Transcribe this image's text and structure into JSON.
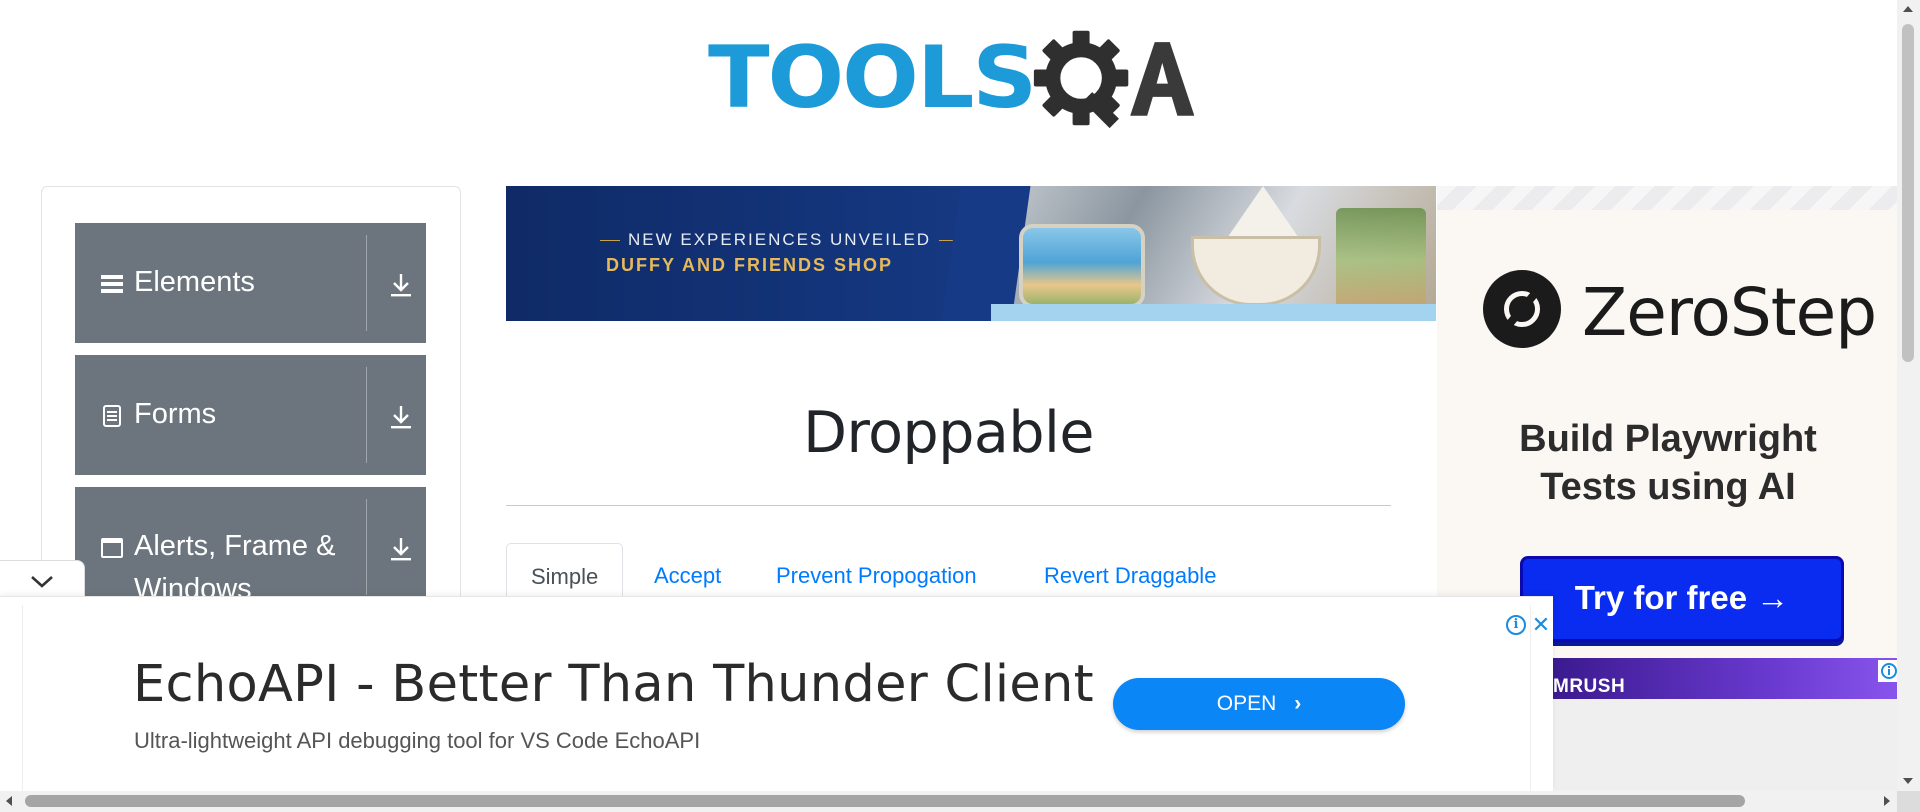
{
  "logo": {
    "text_tools": "TOOLS",
    "text_qa": "QA"
  },
  "nav": {
    "groups": [
      {
        "label": "Elements",
        "icon": "hamburger-icon"
      },
      {
        "label": "Forms",
        "icon": "document-icon"
      },
      {
        "label": "Alerts, Frame & Windows",
        "icon": "window-icon"
      }
    ],
    "group_icon_color": "#6c757d"
  },
  "top_banner": {
    "kicker": "NEW EXPERIENCES UNVEILED",
    "headline": "DUFFY AND FRIENDS SHOP"
  },
  "main": {
    "title": "Droppable",
    "tabs": [
      {
        "label": "Simple",
        "active": true
      },
      {
        "label": "Accept",
        "active": false
      },
      {
        "label": "Prevent Propogation",
        "active": false
      },
      {
        "label": "Revert Draggable",
        "active": false
      }
    ],
    "link_color": "#007bff"
  },
  "right_ad": {
    "brand": "ZeroStep",
    "tagline_line1": "Build Playwright",
    "tagline_line2": "Tests using AI",
    "cta": "Try for free →",
    "cta_color": "#0a2bf0"
  },
  "semrush_ad": {
    "brand": "MRUSH"
  },
  "bottom_ad": {
    "title": "EchoAPI - Better Than Thunder Client",
    "description": "Ultra-lightweight API debugging tool for VS Code EchoAPI",
    "cta": "OPEN",
    "info_glyph": "i",
    "close_glyph": "✕",
    "cta_color": "#0b86f7"
  },
  "collapse_toggle": {
    "icon": "chevron-down-icon"
  }
}
